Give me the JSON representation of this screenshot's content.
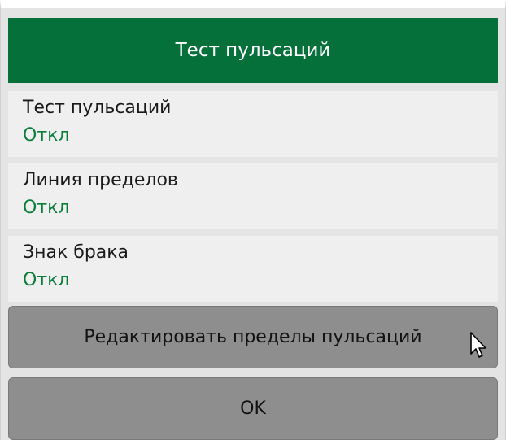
{
  "header": {
    "title": "Тест пульсаций"
  },
  "items": [
    {
      "label": "Тест пульсаций",
      "value": "Откл"
    },
    {
      "label": "Линия пределов",
      "value": "Откл"
    },
    {
      "label": "Знак брака",
      "value": "Откл"
    }
  ],
  "buttons": {
    "edit_limits": "Редактировать пределы пульсаций",
    "ok": "OK"
  },
  "colors": {
    "header_bg": "#05703a",
    "value_text": "#0b7d3a",
    "button_bg": "#8e8e8e"
  },
  "icons": {
    "pointer": "mouse-pointer-icon"
  }
}
